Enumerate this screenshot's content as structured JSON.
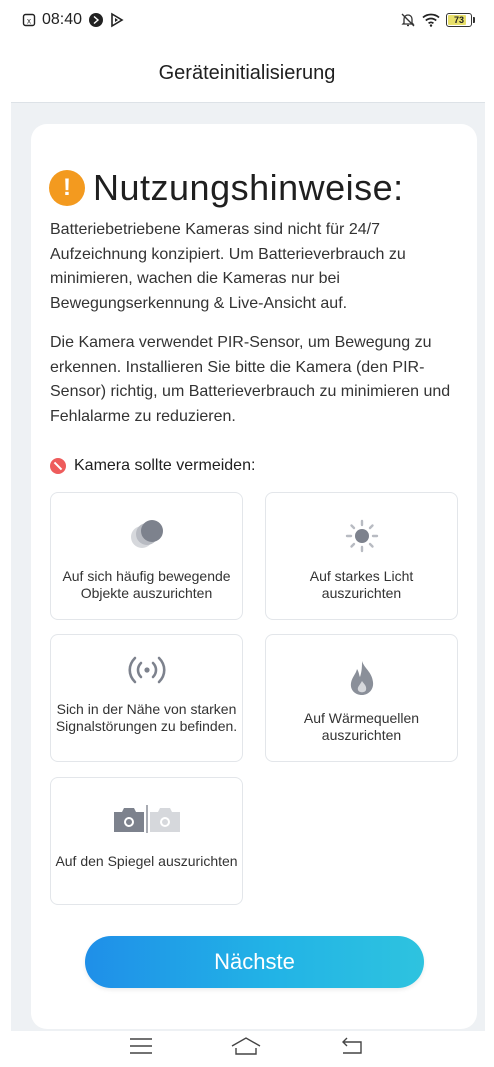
{
  "status_bar": {
    "time": "08:40",
    "battery": "73",
    "icons": [
      "sim-icon",
      "alarm-icon",
      "play-icon",
      "silent-icon",
      "wifi-icon",
      "battery-icon"
    ]
  },
  "header": {
    "title": "Geräteinitialisierung"
  },
  "notice": {
    "title": "Nutzungshinweise:",
    "icon": "warning-icon",
    "para1": "Batteriebetriebene Kameras sind nicht für 24/7 Aufzeichnung konzipiert. Um Batterieverbrauch zu minimieren, wachen die Kameras nur bei Bewegungserkennung & Live-Ansicht auf.",
    "para2": "Die Kamera verwendet PIR-Sensor, um Bewegung zu erkennen. Installieren Sie bitte die Kamera (den PIR-Sensor) richtig, um Batterieverbrauch zu minimieren und Fehlalarme zu reduzieren."
  },
  "avoid": {
    "heading": "Kamera sollte vermeiden:",
    "items": [
      {
        "icon": "moving-objects-icon",
        "label": "Auf sich häufig bewegende Objekte auszurichten"
      },
      {
        "icon": "sun-icon",
        "label": "Auf starkes Licht auszurichten"
      },
      {
        "icon": "signal-icon",
        "label": "Sich in der Nähe von starken Signalstörungen zu befinden."
      },
      {
        "icon": "flame-icon",
        "label": "Auf Wärmequellen auszurichten"
      },
      {
        "icon": "mirror-camera-icon",
        "label": "Auf den Spiegel auszurichten"
      }
    ]
  },
  "next_button": {
    "label": "Nächste"
  },
  "colors": {
    "accent_start": "#1f8fe8",
    "accent_end": "#2ec3df",
    "warning": "#f39a1f",
    "danger": "#ee5c5c",
    "icon_gray": "#8a8f99"
  }
}
